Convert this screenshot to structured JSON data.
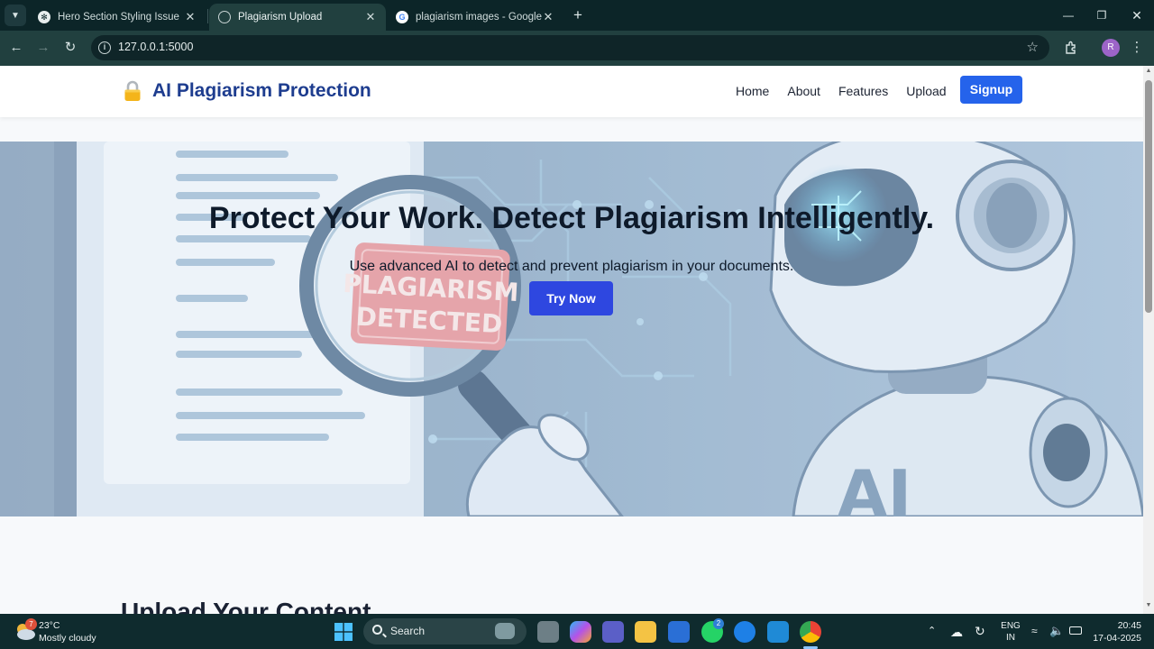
{
  "browser": {
    "tabs": [
      {
        "title": "Hero Section Styling Issue",
        "active": false,
        "favicon": "chatgpt-icon"
      },
      {
        "title": "Plagiarism Upload",
        "active": true,
        "favicon": "globe-icon"
      },
      {
        "title": "plagiarism images - Google Sea",
        "active": false,
        "favicon": "google-icon"
      }
    ],
    "url": "127.0.0.1:5000",
    "profile_initial": "R"
  },
  "site": {
    "brand_icon": "lock-icon",
    "brand": "AI Plagiarism Protection",
    "nav": [
      "Home",
      "About",
      "Features",
      "Upload"
    ],
    "signup_label": "Signup",
    "brand_color": "#1e3d8f",
    "accent_color": "#2563eb"
  },
  "hero": {
    "title": "Protect Your Work. Detect Plagiarism Intelligently.",
    "subtitle": "Use advanced AI to detect and prevent plagiarism in your documents.",
    "cta_label": "Try Now",
    "image_stamp_line1": "PLAGIARISM",
    "image_stamp_line2": "DETECTED",
    "image_robot_label": "AI"
  },
  "upload": {
    "heading": "Upload Your Content"
  },
  "taskbar": {
    "weather_badge": "7",
    "temperature": "23°C",
    "condition": "Mostly cloudy",
    "search_label": "Search",
    "whatsapp_badge": "2",
    "lang_line1": "ENG",
    "lang_line2": "IN",
    "time": "20:45",
    "date": "17-04-2025"
  }
}
